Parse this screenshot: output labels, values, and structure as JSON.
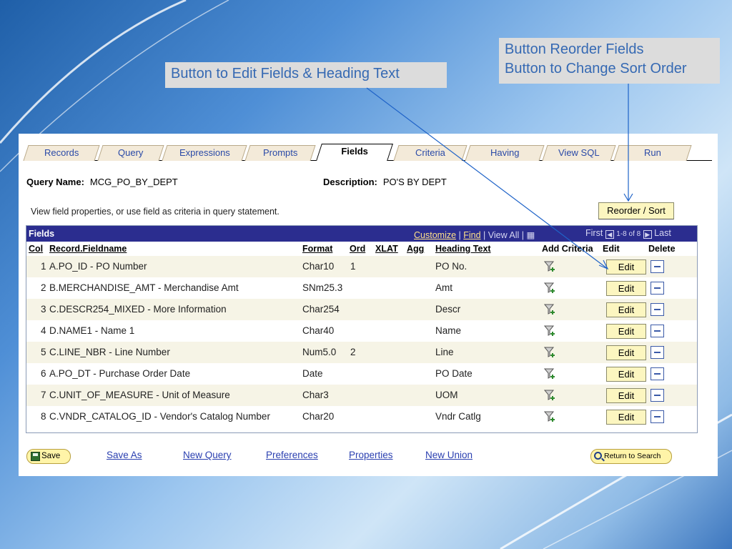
{
  "callouts": {
    "edit": "Button  to Edit Fields & Heading Text",
    "reorder_line1": "Button Reorder Fields",
    "reorder_line2": "Button to Change Sort Order"
  },
  "tabs": [
    "Records",
    "Query",
    "Expressions",
    "Prompts",
    "Fields",
    "Criteria",
    "Having",
    "View SQL",
    "Run"
  ],
  "active_tab": "Fields",
  "query": {
    "name_label": "Query Name:",
    "name_value": "MCG_PO_BY_DEPT",
    "desc_label": "Description:",
    "desc_value": "PO'S BY DEPT",
    "hint": "View field properties, or use field as criteria in query statement."
  },
  "reorder_label": "Reorder / Sort",
  "grid": {
    "title": "Fields",
    "customize": "Customize",
    "find": "Find",
    "view_all": "View All",
    "first": "First",
    "range": "1-8 of 8",
    "last": "Last",
    "headers": {
      "col": "Col",
      "field": "Record.Fieldname",
      "format": "Format",
      "ord": "Ord",
      "xlat": "XLAT",
      "agg": "Agg",
      "heading": "Heading Text",
      "add_criteria": "Add Criteria",
      "edit": "Edit",
      "delete": "Delete"
    },
    "rows": [
      {
        "col": "1",
        "field": "A.PO_ID - PO Number",
        "format": "Char10",
        "ord": "1",
        "heading": "PO No."
      },
      {
        "col": "2",
        "field": "B.MERCHANDISE_AMT - Merchandise Amt",
        "format": "SNm25.3",
        "ord": "",
        "heading": "Amt"
      },
      {
        "col": "3",
        "field": "C.DESCR254_MIXED - More Information",
        "format": "Char254",
        "ord": "",
        "heading": "Descr"
      },
      {
        "col": "4",
        "field": "D.NAME1 - Name 1",
        "format": "Char40",
        "ord": "",
        "heading": "Name"
      },
      {
        "col": "5",
        "field": "C.LINE_NBR - Line Number",
        "format": "Num5.0",
        "ord": "2",
        "heading": "Line"
      },
      {
        "col": "6",
        "field": "A.PO_DT - Purchase Order Date",
        "format": "Date",
        "ord": "",
        "heading": "PO Date"
      },
      {
        "col": "7",
        "field": "C.UNIT_OF_MEASURE - Unit of Measure",
        "format": "Char3",
        "ord": "",
        "heading": "UOM"
      },
      {
        "col": "8",
        "field": "C.VNDR_CATALOG_ID - Vendor's Catalog Number",
        "format": "Char20",
        "ord": "",
        "heading": "Vndr Catlg"
      }
    ],
    "edit_label": "Edit"
  },
  "footer": {
    "save": "Save",
    "save_as": "Save As",
    "new_query": "New Query",
    "preferences": "Preferences",
    "properties": "Properties",
    "new_union": "New Union",
    "return_to_search": "Return to Search"
  },
  "colors": {
    "grid_header": "#2b2d8f",
    "button_fill": "#fcf6c0",
    "link": "#2a3fb0",
    "callout_text": "#3569b3"
  }
}
